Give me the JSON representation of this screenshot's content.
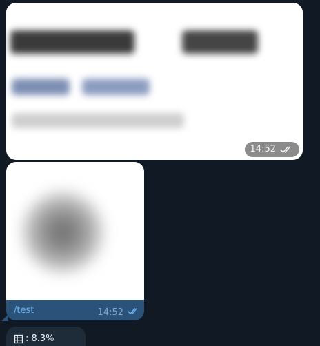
{
  "messages": [
    {
      "type": "text",
      "time": "14:52",
      "status_icon": "double-check-icon",
      "content_blurred": true
    },
    {
      "type": "photo",
      "caption": "/test",
      "time": "14:52",
      "status_icon": "double-check-icon",
      "content_blurred": true
    },
    {
      "type": "text",
      "icon": "grid-icon",
      "text": ": 8.3%"
    }
  ],
  "colors": {
    "background": "#111a24",
    "outgoing_bubble": "#2b5278",
    "incoming_bubble": "#1e2b38",
    "link": "#6ab2f2",
    "time_pill": "#8b8b8b"
  }
}
